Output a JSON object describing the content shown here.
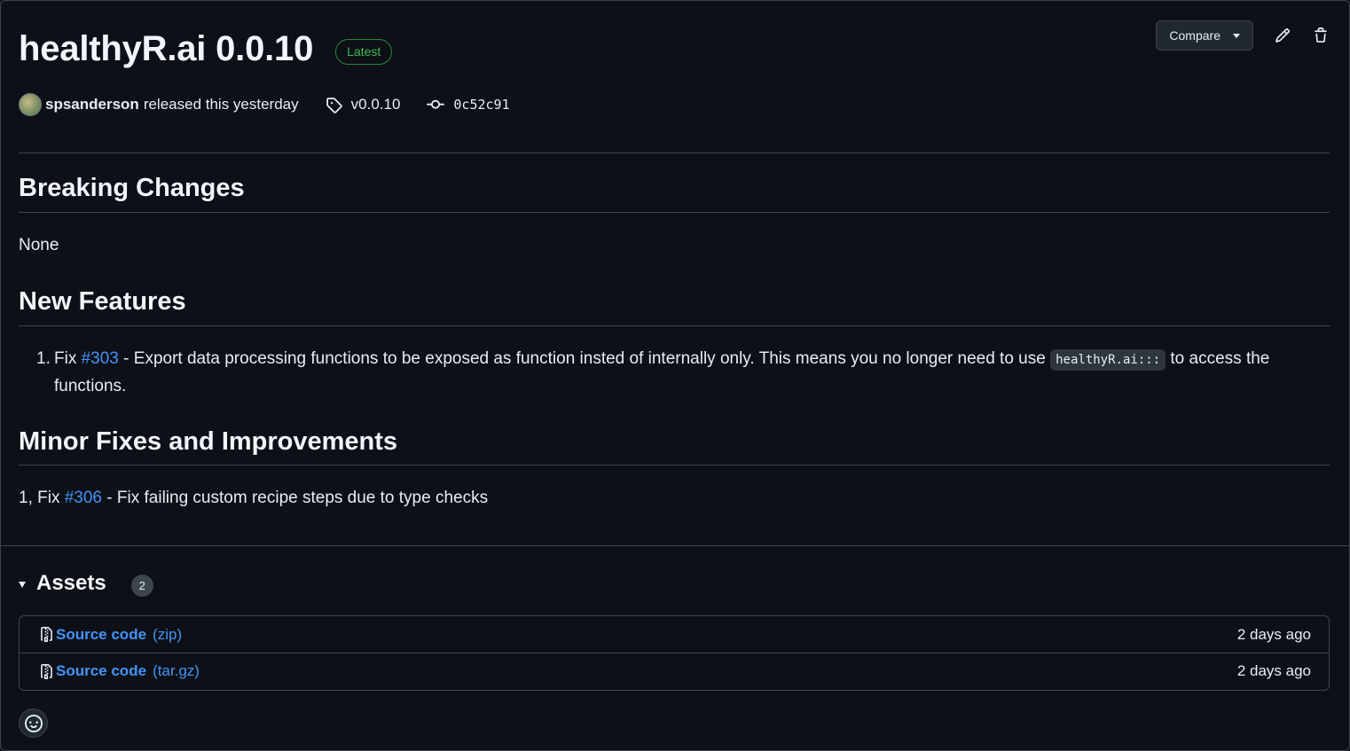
{
  "release": {
    "title": "healthyR.ai 0.0.10",
    "latest_label": "Latest",
    "author": "spsanderson",
    "released_text": "released this yesterday",
    "tag": "v0.0.10",
    "commit": "0c52c91"
  },
  "actions": {
    "compare_label": "Compare",
    "edit_icon": "pencil-icon",
    "delete_icon": "trash-icon"
  },
  "sections": {
    "breaking": {
      "heading": "Breaking Changes",
      "body": "None"
    },
    "features": {
      "heading": "New Features",
      "item_number": "1.",
      "item_prefix": "Fix",
      "item_link": "#303",
      "item_text_a": "- Export data processing functions to be exposed as function insted of internally only. This means you no longer need to use",
      "item_code": "healthyR.ai:::",
      "item_text_b": "to access the functions."
    },
    "fixes": {
      "heading": "Minor Fixes and Improvements",
      "prefix": "1, Fix",
      "link": "#306",
      "text": "- Fix failing custom recipe steps due to type checks"
    }
  },
  "assets": {
    "title": "Assets",
    "count": "2",
    "items": [
      {
        "name": "Source code",
        "format": "(zip)",
        "date": "2 days ago",
        "icon": "file-zip-icon"
      },
      {
        "name": "Source code",
        "format": "(tar.gz)",
        "date": "2 days ago",
        "icon": "file-zip-icon"
      }
    ]
  },
  "reactions": {
    "icon": "smiley-icon"
  },
  "colors": {
    "background": "#0d1117",
    "border": "#3d444d",
    "link": "#4493f8",
    "latest_green": "#3fb950"
  }
}
